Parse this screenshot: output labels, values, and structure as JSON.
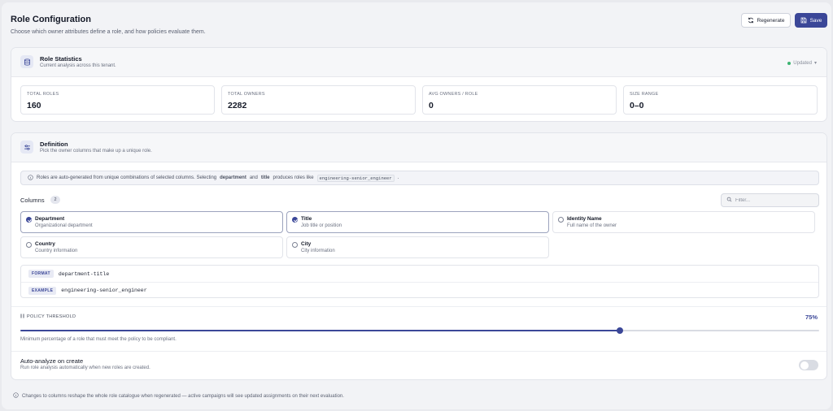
{
  "header": {
    "title": "Role Configuration",
    "subtitle": "Choose which owner attributes define a role, and how policies evaluate them.",
    "regenerate_label": "Regenerate",
    "save_label": "Save"
  },
  "stats_card": {
    "title": "Role Statistics",
    "subtitle": "Current analysis across this tenant.",
    "status": "Updated",
    "stats": [
      {
        "label": "TOTAL ROLES",
        "value": "160"
      },
      {
        "label": "TOTAL OWNERS",
        "value": "2282"
      },
      {
        "label": "AVG OWNERS / ROLE",
        "value": "0"
      },
      {
        "label": "SIZE RANGE",
        "value": "0–0"
      }
    ]
  },
  "definition_card": {
    "title": "Definition",
    "subtitle": "Pick the owner columns that make up a unique role.",
    "info": {
      "prefix": "Roles are auto-generated from unique combinations of selected columns. Selecting",
      "bold1": "department",
      "and": "and",
      "bold2": "title",
      "middle": "produces roles like",
      "code": "engineering-senior_engineer",
      "suffix": "."
    },
    "columns_label": "Columns",
    "columns_count": "2",
    "filter_placeholder": "Filter...",
    "columns": [
      {
        "title": "Department",
        "desc": "Organizational department",
        "selected": true
      },
      {
        "title": "Title",
        "desc": "Job title or position",
        "selected": true
      },
      {
        "title": "Identity Name",
        "desc": "Full name of the owner",
        "selected": false
      },
      {
        "title": "Country",
        "desc": "Country information",
        "selected": false
      },
      {
        "title": "City",
        "desc": "City information",
        "selected": false
      }
    ],
    "format_tag": "FORMAT",
    "format_value": "department-title",
    "example_tag": "EXAMPLE",
    "example_value": "engineering-senior_engineer",
    "threshold_label": "POLICY THRESHOLD",
    "threshold_value": "75%",
    "threshold_fraction": 0.75,
    "threshold_help": "Minimum percentage of a role that must meet the policy to be compliant.",
    "auto_title": "Auto-analyze on create",
    "auto_sub": "Run role analysis automatically when new roles are created."
  },
  "footer": "Changes to columns reshape the whole role catalogue when regenerated — active campaigns will see updated assignments on their next evaluation.",
  "colors": {
    "accent": "#3b4798",
    "status_ok": "#3cb371"
  }
}
